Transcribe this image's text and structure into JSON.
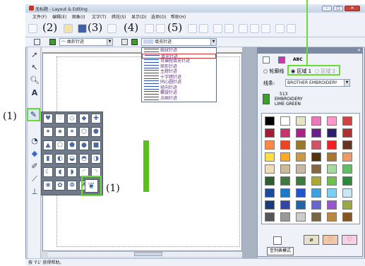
{
  "window": {
    "title": "无标题 - Layout & Editing",
    "minimize": "–",
    "maximize": "□",
    "close": "✕"
  },
  "menu": [
    "文件(F)",
    "编辑(E)",
    "图象(I)",
    "文字(T)",
    "绣花(S)",
    "显示(D)",
    "选项(O)",
    "帮助(H)"
  ],
  "callouts": {
    "n2": "(2)",
    "n3": "(3)",
    "n4": "(4)",
    "n5": "(5)",
    "left1": "(1)",
    "right1": "(1)"
  },
  "toolbar2": {
    "line_sew_label": "曲折针迹",
    "region_sew_label": "填充针迹"
  },
  "region_sew_types": [
    {
      "label": "缎纹针迹",
      "icon": "satin-stitch-icon"
    },
    {
      "label": "填充针迹",
      "icon": "fill-stitch-icon",
      "selected": true
    },
    {
      "label": "可编程填充针迹",
      "icon": "programmable-fill-icon"
    },
    {
      "label": "矩形针迹",
      "icon": "rectangle-stitch-icon"
    },
    {
      "label": "主题针迹",
      "icon": "motif-stitch-icon"
    },
    {
      "label": "十字绣针迹",
      "icon": "cross-stitch-icon"
    },
    {
      "label": "同心圆针迹",
      "icon": "concentric-circle-icon"
    },
    {
      "label": "径向针迹",
      "icon": "radial-stitch-icon"
    },
    {
      "label": "螺旋针迹",
      "icon": "spiral-stitch-icon"
    },
    {
      "label": "点画针迹",
      "icon": "stippling-icon"
    }
  ],
  "right_panel": {
    "radio_outline": "轮廓线",
    "radio_region1": "区域 1",
    "radio_region2": "区域 2",
    "thread_label": "线条:",
    "thread_brand": "BROTHER EMBROIDERY",
    "thread_number": "513",
    "thread_brand_line": "EMBROIDERY",
    "thread_color_name": "LIME GREEN",
    "thread_color": "#3aa02a",
    "list_mode_button": "至列表模式",
    "abc_tab": "ABC"
  },
  "status": {
    "text": "按 'F1' 获得帮助。"
  },
  "palette": [
    "#000000",
    "#ffffff",
    "#e8e4c8",
    "#ee77bb",
    "#ff99cc",
    "#cc4444",
    "#a51c36",
    "#c8326e",
    "#aa2288",
    "#6a1f8a",
    "#2a1f6a",
    "#b03030",
    "#ff8844",
    "#ee4422",
    "#9a7a2a",
    "#cc5566",
    "#ee2222",
    "#663322",
    "#ffdd44",
    "#ffaa22",
    "#cc9944",
    "#553311",
    "#aa7733",
    "#ee9966",
    "#eeddbb",
    "#ccbb99",
    "#c8b8a8",
    "#886644",
    "#a8d8a0",
    "#66bb66",
    "#2e5e2e",
    "#3d7a3d",
    "#3d7a3d",
    "#aaaa33",
    "#6fbf4f",
    "#2a8a3a",
    "#1a4a9a",
    "#1a7acc",
    "#2255cc",
    "#3ea0dd",
    "#7ad0ee",
    "#c8e8f8",
    "#1a3a7a",
    "#3344aa",
    "#2266aa",
    "#6666cc",
    "#9955cc",
    "#99aa44",
    "#555555",
    "#999999",
    "#cccccc",
    "#776644",
    "#bb8844",
    "#885522"
  ]
}
